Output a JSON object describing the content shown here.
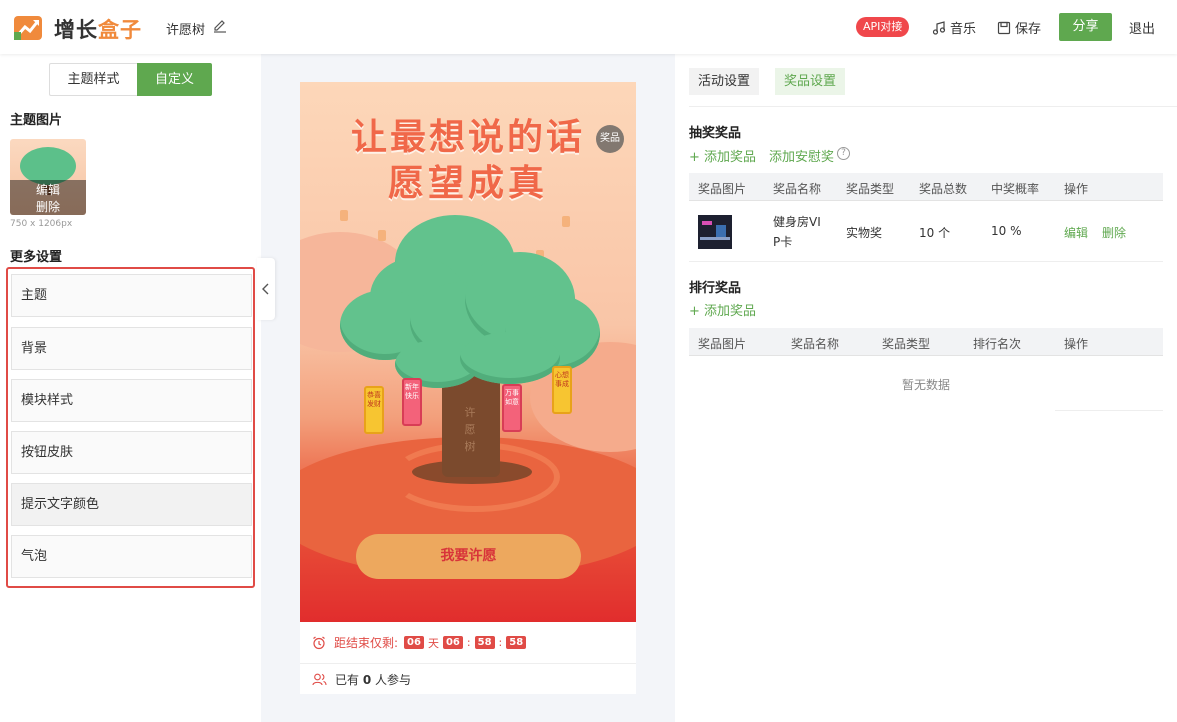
{
  "header": {
    "brand_part1": "增长",
    "brand_part2": "盒子",
    "page_name": "许愿树",
    "api_badge": "API对接",
    "music": "音乐",
    "save": "保存",
    "share": "分享",
    "logout": "退出"
  },
  "left": {
    "seg_theme_style": "主题样式",
    "seg_custom": "自定义",
    "theme_image_title": "主题图片",
    "thumb_edit": "编辑",
    "thumb_delete": "删除",
    "thumb_size": "750 x 1206px",
    "more_settings_title": "更多设置",
    "settings": [
      "主题",
      "背景",
      "模块样式",
      "按钮皮肤",
      "提示文字颜色",
      "气泡"
    ]
  },
  "preview": {
    "headline1": "让最想说的话",
    "headline2": "愿望成真",
    "prize_badge": "奖品",
    "trunk_text": "许愿树",
    "tags": [
      "恭喜发财",
      "新年快乐",
      "万事如意",
      "心想事成"
    ],
    "wish_button": "我要许愿",
    "countdown_label": "距结束仅剩:",
    "cd_days": "06",
    "cd_day_unit": "天",
    "cd_hours": "06",
    "cd_minutes": "58",
    "cd_seconds": "58",
    "participants_prefix": "已有",
    "participants_count": "0",
    "participants_suffix": "人参与"
  },
  "right": {
    "tab_activity": "活动设置",
    "tab_prize": "奖品设置",
    "lottery_title": "抽奖奖品",
    "add_prize": "添加奖品",
    "add_consolation": "添加安慰奖",
    "lottery_columns": [
      "奖品图片",
      "奖品名称",
      "奖品类型",
      "奖品总数",
      "中奖概率",
      "操作"
    ],
    "lottery_rows": [
      {
        "name_line1": "健身房VI",
        "name_line2": "P卡",
        "type": "实物奖",
        "total": "10 个",
        "prob": "10 %",
        "edit": "编辑",
        "delete": "删除"
      }
    ],
    "rank_title": "排行奖品",
    "rank_add": "添加奖品",
    "rank_columns": [
      "奖品图片",
      "奖品名称",
      "奖品类型",
      "排行名次",
      "操作"
    ],
    "empty_text": "暂无数据"
  },
  "colors": {
    "primary_green": "#5fa84f",
    "brand_orange": "#f08a3c",
    "highlight_red": "#e04b46"
  }
}
